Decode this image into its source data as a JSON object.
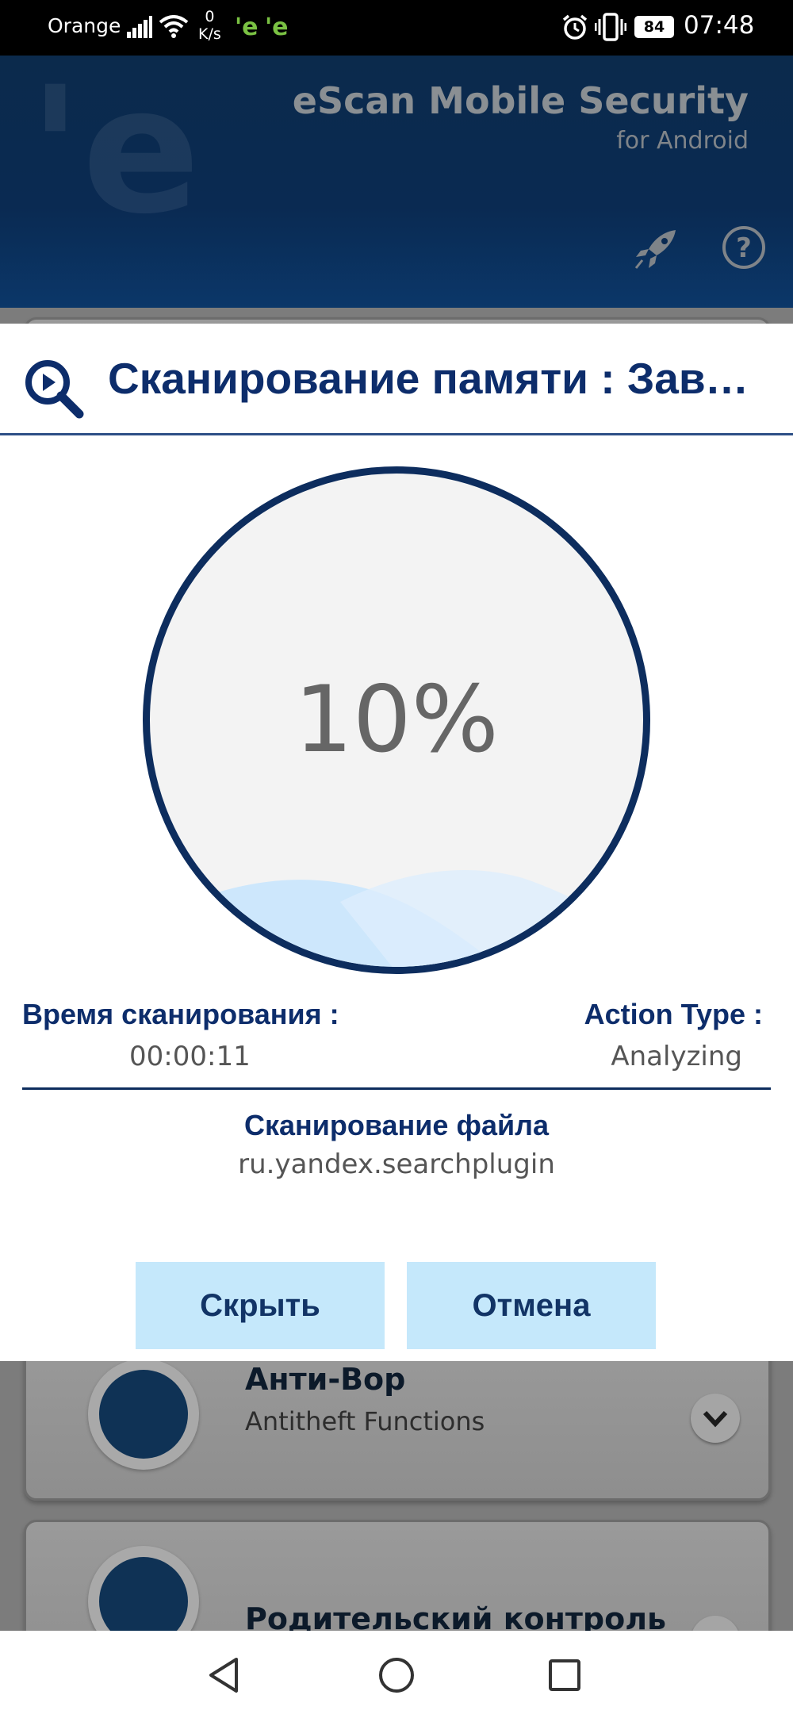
{
  "status_bar": {
    "carrier": "Orange",
    "speed_value": "0",
    "speed_unit": "K/s",
    "battery": "84",
    "time": "07:48"
  },
  "app_header": {
    "title": "eScan Mobile Security",
    "subtitle": "for Android"
  },
  "feature_list": [
    {
      "title": "Анти-Вор",
      "subtitle": "Antitheft Functions"
    },
    {
      "title": "Родительский контроль",
      "subtitle": ""
    }
  ],
  "scan_dialog": {
    "title": "Сканирование памяти : Завершение",
    "progress_percent": 10,
    "progress_label": "10%",
    "scan_time_label": "Время сканирования :",
    "scan_time_value": "00:00:11",
    "action_type_label": "Action Type :",
    "action_type_value": "Analyzing",
    "scanning_file_label": "Сканирование файла",
    "scanning_file_value": "ru.yandex.searchplugin",
    "hide_button": "Скрыть",
    "cancel_button": "Отмена"
  },
  "colors": {
    "accent_dark_blue": "#0d2d6b",
    "button_bg": "#c5e8fb",
    "header_bg": "#0a2a52"
  }
}
